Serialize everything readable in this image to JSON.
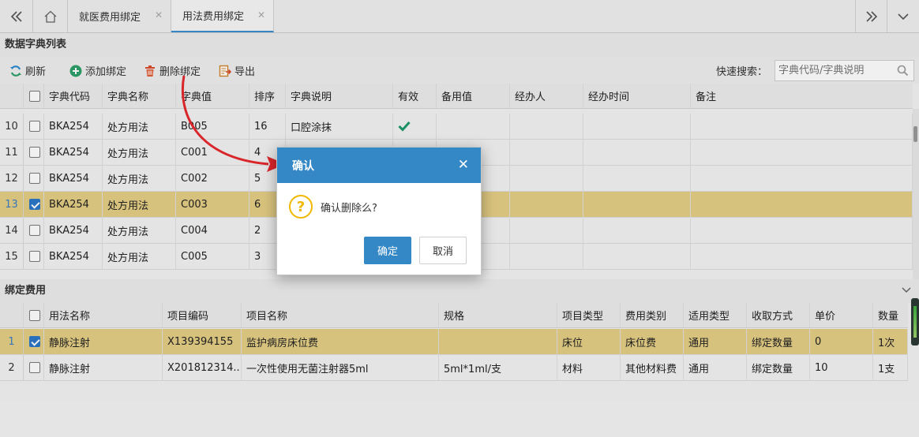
{
  "tabs": {
    "nav_left_icon": "double-chevron-left-icon",
    "home_icon": "home-icon",
    "items": [
      {
        "label": "就医费用绑定",
        "active": false
      },
      {
        "label": "用法费用绑定",
        "active": true
      }
    ],
    "nav_right_icon": "double-chevron-right-icon",
    "dropdown_icon": "chevron-down-icon"
  },
  "dict_panel": {
    "title": "数据字典列表",
    "toolbar": {
      "refresh": "刷新",
      "add": "添加绑定",
      "delete": "删除绑定",
      "export": "导出",
      "search_label": "快速搜索：",
      "search_placeholder": "字典代码/字典说明"
    },
    "columns": [
      "字典代码",
      "字典名称",
      "字典值",
      "排序",
      "字典说明",
      "有效",
      "备用值",
      "经办人",
      "经办时间",
      "备注"
    ],
    "rows": [
      {
        "num": "10",
        "checked": false,
        "code": "BKA254",
        "name": "处方用法",
        "value": "B005",
        "order": "16",
        "desc": "口腔涂抹",
        "valid": true,
        "selected": false
      },
      {
        "num": "11",
        "checked": false,
        "code": "BKA254",
        "name": "处方用法",
        "value": "C001",
        "order": "4",
        "desc": "",
        "valid": false,
        "selected": false
      },
      {
        "num": "12",
        "checked": false,
        "code": "BKA254",
        "name": "处方用法",
        "value": "C002",
        "order": "5",
        "desc": "",
        "valid": false,
        "selected": false
      },
      {
        "num": "13",
        "checked": true,
        "code": "BKA254",
        "name": "处方用法",
        "value": "C003",
        "order": "6",
        "desc": "",
        "valid": false,
        "selected": true
      },
      {
        "num": "14",
        "checked": false,
        "code": "BKA254",
        "name": "处方用法",
        "value": "C004",
        "order": "2",
        "desc": "",
        "valid": false,
        "selected": false
      },
      {
        "num": "15",
        "checked": false,
        "code": "BKA254",
        "name": "处方用法",
        "value": "C005",
        "order": "3",
        "desc": "",
        "valid": false,
        "selected": false
      }
    ]
  },
  "fee_panel": {
    "title": "绑定费用",
    "columns": [
      "用法名称",
      "项目编码",
      "项目名称",
      "规格",
      "项目类型",
      "费用类别",
      "适用类型",
      "收取方式",
      "单价",
      "数量"
    ],
    "rows": [
      {
        "num": "1",
        "checked": true,
        "usage": "静脉注射",
        "code": "X139394155",
        "name": "监护病房床位费",
        "spec": "",
        "item_type": "床位",
        "fee_cat": "床位费",
        "apply": "通用",
        "charge": "绑定数量",
        "price": "0",
        "qty": "1次",
        "selected": true
      },
      {
        "num": "2",
        "checked": false,
        "usage": "静脉注射",
        "code": "X201812314...",
        "name": "一次性使用无菌注射器5ml",
        "spec": "5ml*1ml/支",
        "item_type": "材料",
        "fee_cat": "其他材料费",
        "apply": "通用",
        "charge": "绑定数量",
        "price": "10",
        "qty": "1支",
        "selected": false
      }
    ]
  },
  "dialog": {
    "title": "确认",
    "message": "确认删除么?",
    "ok": "确定",
    "cancel": "取消"
  },
  "colors": {
    "accent": "#3588c6",
    "selected_row": "#e5cf85",
    "check_green": "#1a9a6a",
    "arrow_red": "#d9262b"
  }
}
